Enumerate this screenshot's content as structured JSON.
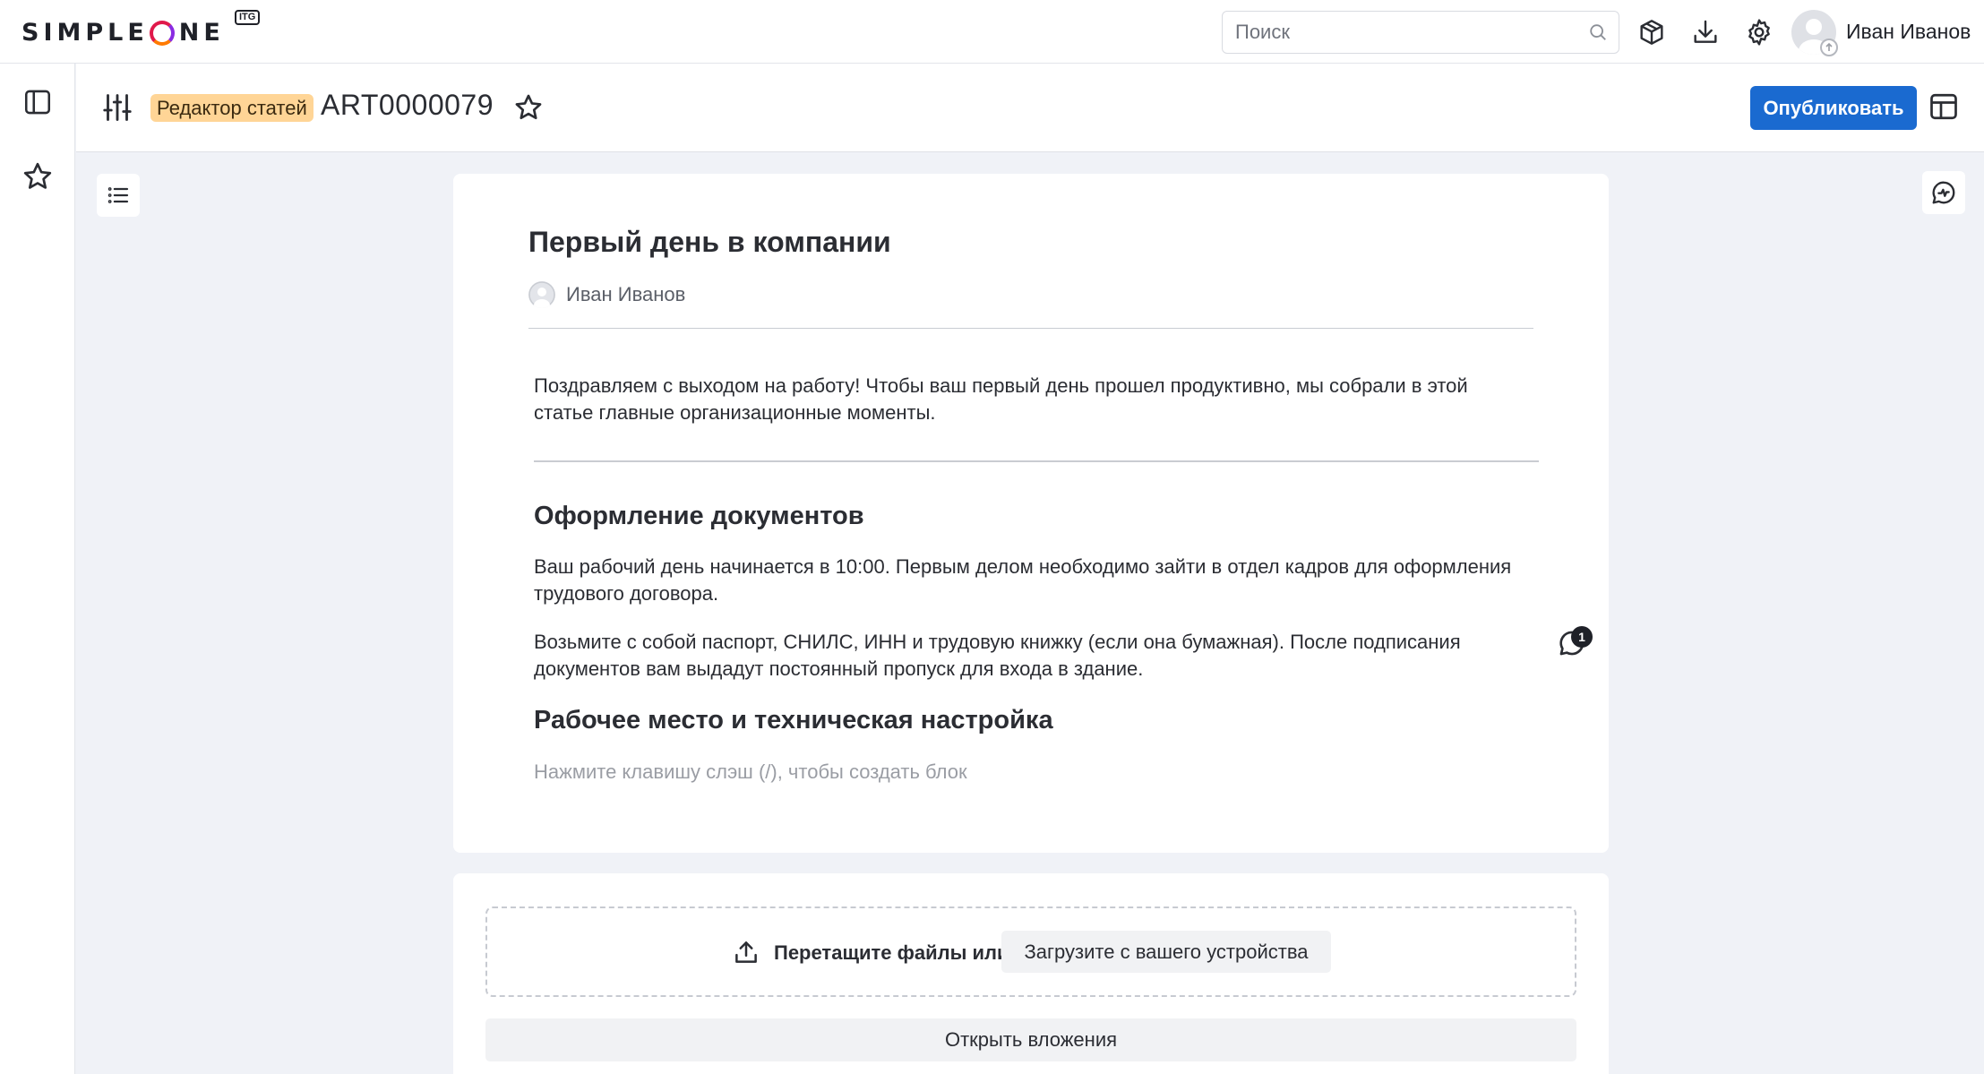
{
  "app": {
    "logo_text_1": "SIMPLE",
    "logo_text_2": "NE",
    "logo_badge": "ITG"
  },
  "topbar": {
    "search_placeholder": "Поиск",
    "user_name": "Иван Иванов",
    "icons": [
      "search-icon",
      "package-icon",
      "download-icon",
      "gear-icon",
      "avatar-icon"
    ]
  },
  "header": {
    "chip_label": "Редактор статей",
    "record_id": "ART0000079",
    "publish_label": "Опубликовать"
  },
  "article": {
    "title": "Первый день в компании",
    "author": "Иван Иванов",
    "intro": "Поздравляем с выходом на работу! Чтобы ваш первый день прошел продуктивно, мы собрали в этой статье главные организационные моменты.",
    "section_1_title": "Оформление документов",
    "section_1_p1": "Ваш рабочий день начинается в 10:00. Первым делом необходимо зайти в отдел кадров для оформления трудового договора.",
    "section_1_p2": "Возьмите с собой паспорт, СНИЛС, ИНН и трудовую книжку (если она бумажная). После подписания документов вам выдадут постоянный пропуск для входа в здание.",
    "section_2_title": "Рабочее место и техническая настройка",
    "block_placeholder": "Нажмите клавишу слэш (/), чтобы создать блок",
    "comment_count": "1"
  },
  "attachments": {
    "drop_text": "Перетащите файлы или",
    "upload_label": "Загрузите с вашего устройства",
    "open_label": "Открыть вложения"
  },
  "colors": {
    "accent": "#1a6ad0",
    "chip_bg": "#ffd596",
    "page_bg": "#f0f2f7"
  }
}
